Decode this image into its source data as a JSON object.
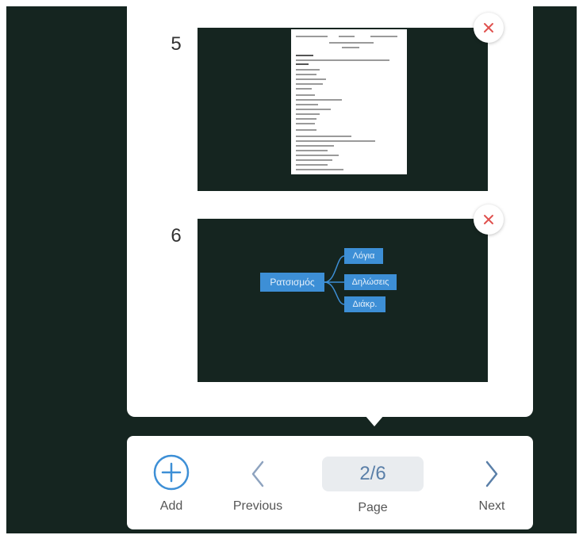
{
  "pages": [
    {
      "number": "5",
      "kind": "document"
    },
    {
      "number": "6",
      "kind": "mindmap",
      "mindmap": {
        "root": "Ρατσισμός",
        "children": [
          "Λόγια",
          "Δηλώσεις",
          "Διάκρ."
        ]
      }
    }
  ],
  "toolbar": {
    "add_label": "Add",
    "previous_label": "Previous",
    "page_value": "2/6",
    "page_label": "Page",
    "next_label": "Next"
  },
  "colors": {
    "background": "#152520",
    "accent": "#3d8fd6",
    "close": "#e0524f"
  },
  "icons": [
    "close-icon",
    "add-circle-icon",
    "chevron-left-icon",
    "chevron-right-icon"
  ]
}
